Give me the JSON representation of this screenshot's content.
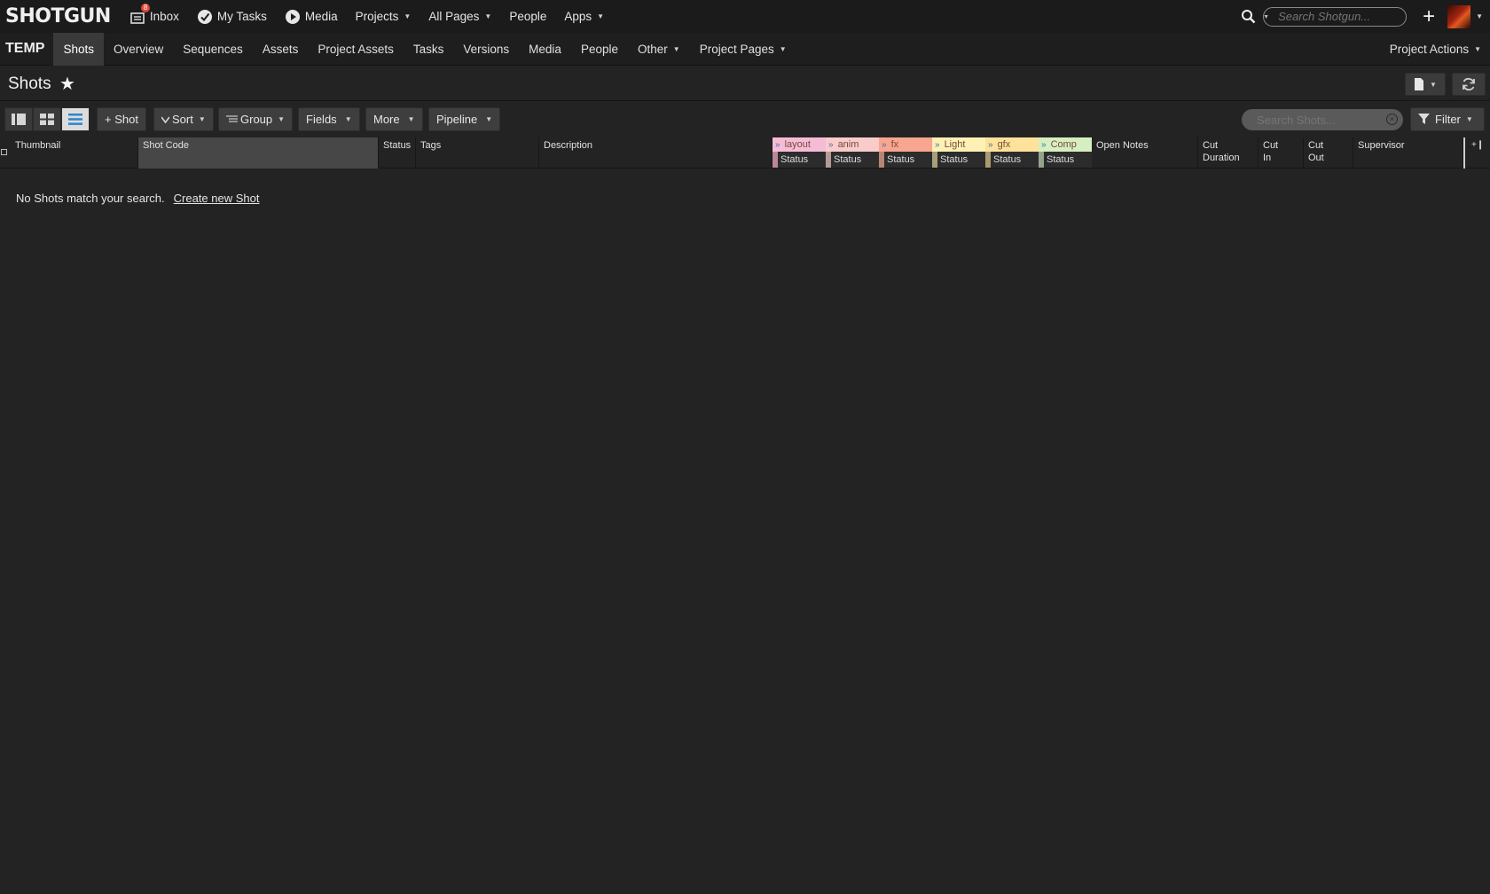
{
  "logo": "SHOTGUN",
  "global_nav": {
    "inbox": {
      "label": "Inbox",
      "badge": "8"
    },
    "my_tasks": "My Tasks",
    "media": "Media",
    "projects": "Projects",
    "all_pages": "All Pages",
    "people": "People",
    "apps": "Apps",
    "search_placeholder": "Search Shotgun..."
  },
  "project_nav": {
    "project_name": "TEMP",
    "tabs": [
      {
        "label": "Shots",
        "active": true,
        "dropdown": false
      },
      {
        "label": "Overview",
        "dropdown": false
      },
      {
        "label": "Sequences",
        "dropdown": false
      },
      {
        "label": "Assets",
        "dropdown": false
      },
      {
        "label": "Project Assets",
        "dropdown": false
      },
      {
        "label": "Tasks",
        "dropdown": false
      },
      {
        "label": "Versions",
        "dropdown": false
      },
      {
        "label": "Media",
        "dropdown": false
      },
      {
        "label": "People",
        "dropdown": false
      },
      {
        "label": "Other",
        "dropdown": true
      },
      {
        "label": "Project Pages",
        "dropdown": true
      }
    ],
    "project_actions": "Project Actions"
  },
  "page": {
    "title": "Shots",
    "favorite_glyph": "★"
  },
  "toolbar": {
    "add_shot": "+ Shot",
    "sort": "Sort",
    "group": "Group",
    "fields": "Fields",
    "more": "More",
    "pipeline": "Pipeline",
    "search_placeholder": "Search Shots...",
    "filter": "Filter"
  },
  "grid": {
    "columns": {
      "thumbnail": "Thumbnail",
      "shot_code": "Shot Code",
      "status": "Status",
      "tags": "Tags",
      "description": "Description",
      "open_notes": "Open Notes",
      "cut_duration": [
        "Cut",
        "Duration"
      ],
      "cut_in": [
        "Cut",
        "In"
      ],
      "cut_out": [
        "Cut",
        "Out"
      ],
      "supervisor": "Supervisor"
    },
    "pipeline_steps": [
      {
        "name": "layout",
        "sub": "Status",
        "color": "#f6bcd6",
        "bar": "#b9879c"
      },
      {
        "name": "anim",
        "sub": "Status",
        "color": "#f9cbcb",
        "bar": "#b79a97"
      },
      {
        "name": "fx",
        "sub": "Status",
        "color": "#f9a690",
        "bar": "#b78572"
      },
      {
        "name": "Light",
        "sub": "Status",
        "color": "#fef1b4",
        "bar": "#a89f78"
      },
      {
        "name": "gfx",
        "sub": "Status",
        "color": "#fde29b",
        "bar": "#a99b6d"
      },
      {
        "name": "Comp",
        "sub": "Status",
        "color": "#d5efc0",
        "bar": "#95a48a"
      }
    ]
  },
  "empty_state": {
    "message": "No Shots match your search.",
    "link": "Create new Shot"
  }
}
